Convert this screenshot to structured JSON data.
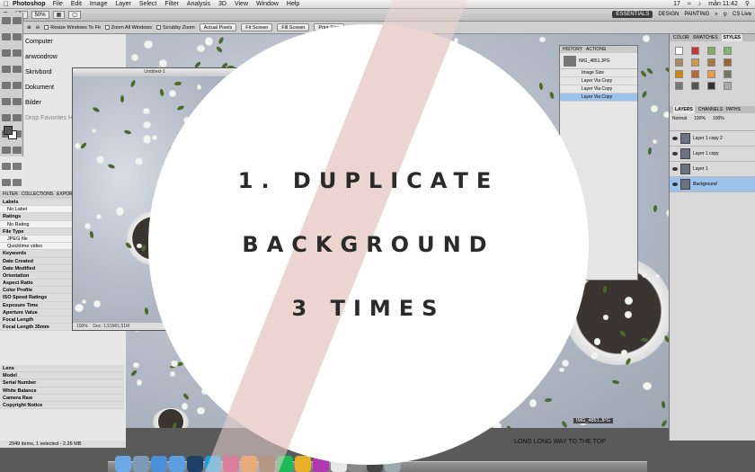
{
  "menubar": {
    "app": "Photoshop",
    "items": [
      "File",
      "Edit",
      "Image",
      "Layer",
      "Select",
      "Filter",
      "Analysis",
      "3D",
      "View",
      "Window",
      "Help"
    ],
    "status_number": "17",
    "clock": "mån 11:42",
    "cs_live": "CS Live"
  },
  "appbar": {
    "zoom": "50%",
    "workspaces": [
      "ESSENTIALS",
      "DESIGN",
      "PAINTING"
    ],
    "more": "»"
  },
  "optionsbar": {
    "checks": [
      "Resize Windows To Fit",
      "Zoom All Windows",
      "Scrubby Zoom"
    ],
    "buttons": [
      "Actual Pixels",
      "Fit Screen",
      "Fill Screen",
      "Print Size"
    ]
  },
  "favorites": [
    "Computer",
    "anwoodrow",
    "Skrivbord",
    "Dokument",
    "Bilder",
    "Drop Favorites Here..."
  ],
  "filter_tabs": [
    "FILTER",
    "COLLECTIONS",
    "EXPORT"
  ],
  "filters": [
    {
      "t": "h",
      "l": "Labels"
    },
    {
      "t": "s",
      "l": "No Label"
    },
    {
      "t": "h",
      "l": "Ratings"
    },
    {
      "t": "s",
      "l": "No Rating"
    },
    {
      "t": "h",
      "l": "File Type"
    },
    {
      "t": "s",
      "l": "JPEG file"
    },
    {
      "t": "s",
      "l": "Quicktime video"
    },
    {
      "t": "h",
      "l": "Keywords"
    },
    {
      "t": "h",
      "l": "Date Created"
    },
    {
      "t": "h",
      "l": "Date Modified"
    },
    {
      "t": "h",
      "l": "Orientation"
    },
    {
      "t": "h",
      "l": "Aspect Ratio"
    },
    {
      "t": "h",
      "l": "Color Profile"
    },
    {
      "t": "h",
      "l": "ISO Speed Ratings"
    },
    {
      "t": "h",
      "l": "Exposure Time"
    },
    {
      "t": "h",
      "l": "Aperture Value"
    },
    {
      "t": "h",
      "l": "Focal Length"
    },
    {
      "t": "h",
      "l": "Focal Length 35mm"
    }
  ],
  "filters_lower": [
    "Lens",
    "Model",
    "Serial Number",
    "White Balance",
    "Camera Raw",
    "Copyright Notice"
  ],
  "document": {
    "title": "Untitled-1",
    "zoom": "100%",
    "doc_info": "Doc: 1,51M/1,51M",
    "file_label": "IMG_4851.JPG"
  },
  "history": {
    "tabs": [
      "HISTORY",
      "ACTIONS"
    ],
    "snapshot": "IMG_4851.JPG",
    "states": [
      "Image Size",
      "Layer Via Copy",
      "Layer Via Copy",
      "Layer Via Copy"
    ],
    "selected_index": 3
  },
  "right_dock": {
    "top_tabs": [
      "COLOR",
      "SWATCHES",
      "STYLES"
    ],
    "layer_tabs": [
      "LAYERS",
      "CHANNELS",
      "PATHS"
    ],
    "blend_mode": "Normal",
    "opacity": "100%",
    "fill": "100%",
    "layers": [
      "Layer 1 copy 2",
      "Layer 1 copy",
      "Layer 1",
      "Background"
    ],
    "selected_layer": "Background"
  },
  "statusline": "2949 items, 1 selected - 2.26 MB",
  "macdock": {
    "icons": [
      "Finder",
      "Mail",
      "Safari",
      "App Store",
      "Photoshop",
      "Skype",
      "InDesign",
      "Illustrator",
      "Bridge",
      "Spotify",
      "Chrome",
      "iTunes",
      "Calendar",
      "Preferences",
      "Photos",
      "Trash"
    ],
    "caption": "LONG LONG WAY TO THE TOP"
  },
  "overlay": {
    "lines": [
      "1. DUPLICATE",
      "BACKGROUND",
      "3 TIMES"
    ],
    "circle_color": "#ffffff",
    "stripe_color": "#ecd5d1"
  }
}
